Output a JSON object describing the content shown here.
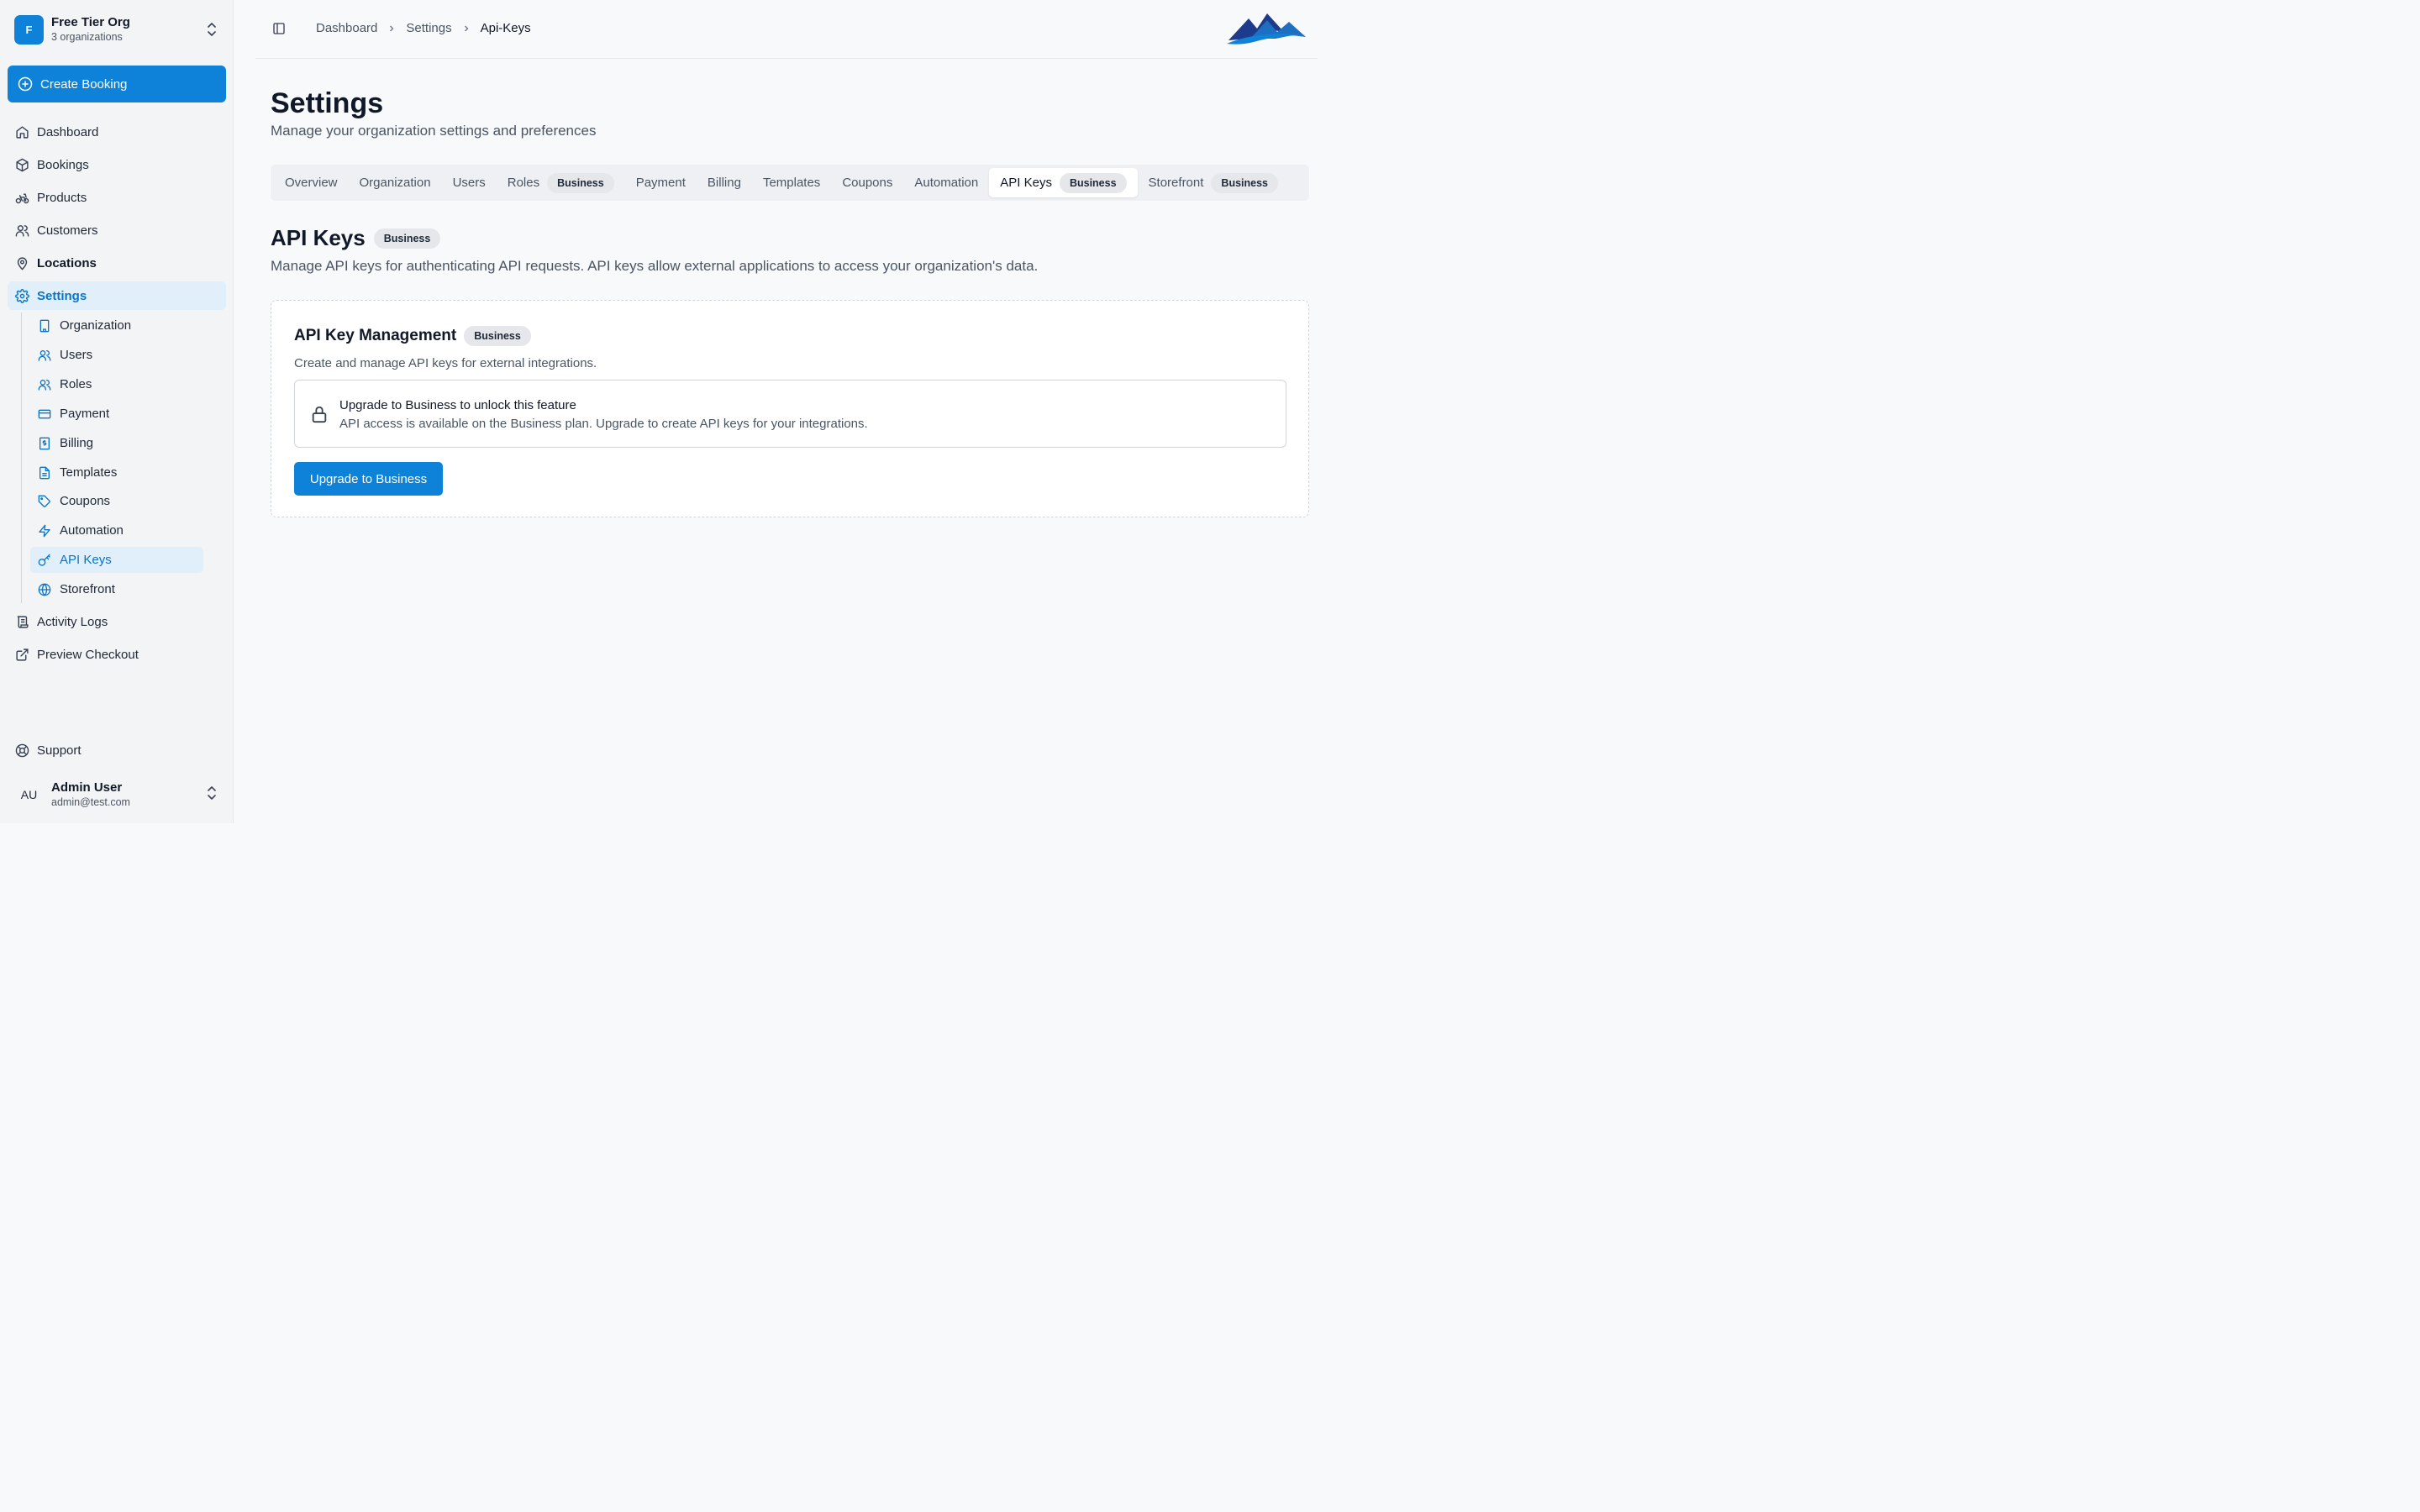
{
  "org": {
    "initial": "F",
    "name": "Free Tier Org",
    "subtitle": "3 organizations"
  },
  "sidebar": {
    "create_label": "Create Booking",
    "items": [
      {
        "label": "Dashboard",
        "icon": "home-icon"
      },
      {
        "label": "Bookings",
        "icon": "box-icon"
      },
      {
        "label": "Products",
        "icon": "bike-icon"
      },
      {
        "label": "Customers",
        "icon": "users-icon"
      },
      {
        "label": "Locations",
        "icon": "map-pin-icon"
      },
      {
        "label": "Settings",
        "icon": "gear-icon"
      }
    ],
    "settings_sub": [
      {
        "label": "Organization",
        "icon": "building-icon"
      },
      {
        "label": "Users",
        "icon": "users-icon"
      },
      {
        "label": "Roles",
        "icon": "users-icon"
      },
      {
        "label": "Payment",
        "icon": "credit-card-icon"
      },
      {
        "label": "Billing",
        "icon": "receipt-icon"
      },
      {
        "label": "Templates",
        "icon": "file-icon"
      },
      {
        "label": "Coupons",
        "icon": "tag-icon"
      },
      {
        "label": "Automation",
        "icon": "zap-icon"
      },
      {
        "label": "API Keys",
        "icon": "key-icon"
      },
      {
        "label": "Storefront",
        "icon": "globe-icon"
      }
    ],
    "bottom_items": [
      {
        "label": "Activity Logs",
        "icon": "scroll-icon"
      },
      {
        "label": "Preview Checkout",
        "icon": "external-link-icon"
      }
    ],
    "support_label": "Support"
  },
  "user": {
    "initials": "AU",
    "name": "Admin User",
    "email": "admin@test.com"
  },
  "breadcrumb": [
    "Dashboard",
    "Settings",
    "Api-Keys"
  ],
  "page": {
    "title": "Settings",
    "subtitle": "Manage your organization settings and preferences"
  },
  "tabs": [
    {
      "label": "Overview",
      "badge": ""
    },
    {
      "label": "Organization",
      "badge": ""
    },
    {
      "label": "Users",
      "badge": ""
    },
    {
      "label": "Roles",
      "badge": "Business"
    },
    {
      "label": "Payment",
      "badge": ""
    },
    {
      "label": "Billing",
      "badge": ""
    },
    {
      "label": "Templates",
      "badge": ""
    },
    {
      "label": "Coupons",
      "badge": ""
    },
    {
      "label": "Automation",
      "badge": ""
    },
    {
      "label": "API Keys",
      "badge": "Business"
    },
    {
      "label": "Storefront",
      "badge": "Business"
    }
  ],
  "section": {
    "title": "API Keys",
    "badge": "Business",
    "description": "Manage API keys for authenticating API requests. API keys allow external applications to access your organization's data."
  },
  "card": {
    "title": "API Key Management",
    "badge": "Business",
    "description": "Create and manage API keys for external integrations.",
    "alert_title": "Upgrade to Business to unlock this feature",
    "alert_desc": "API access is available on the Business plan. Upgrade to create API keys for your integrations.",
    "button_label": "Upgrade to Business"
  },
  "colors": {
    "accent": "#0e82d8",
    "active_bg": "#e0effa",
    "active_text": "#0b74c4"
  }
}
